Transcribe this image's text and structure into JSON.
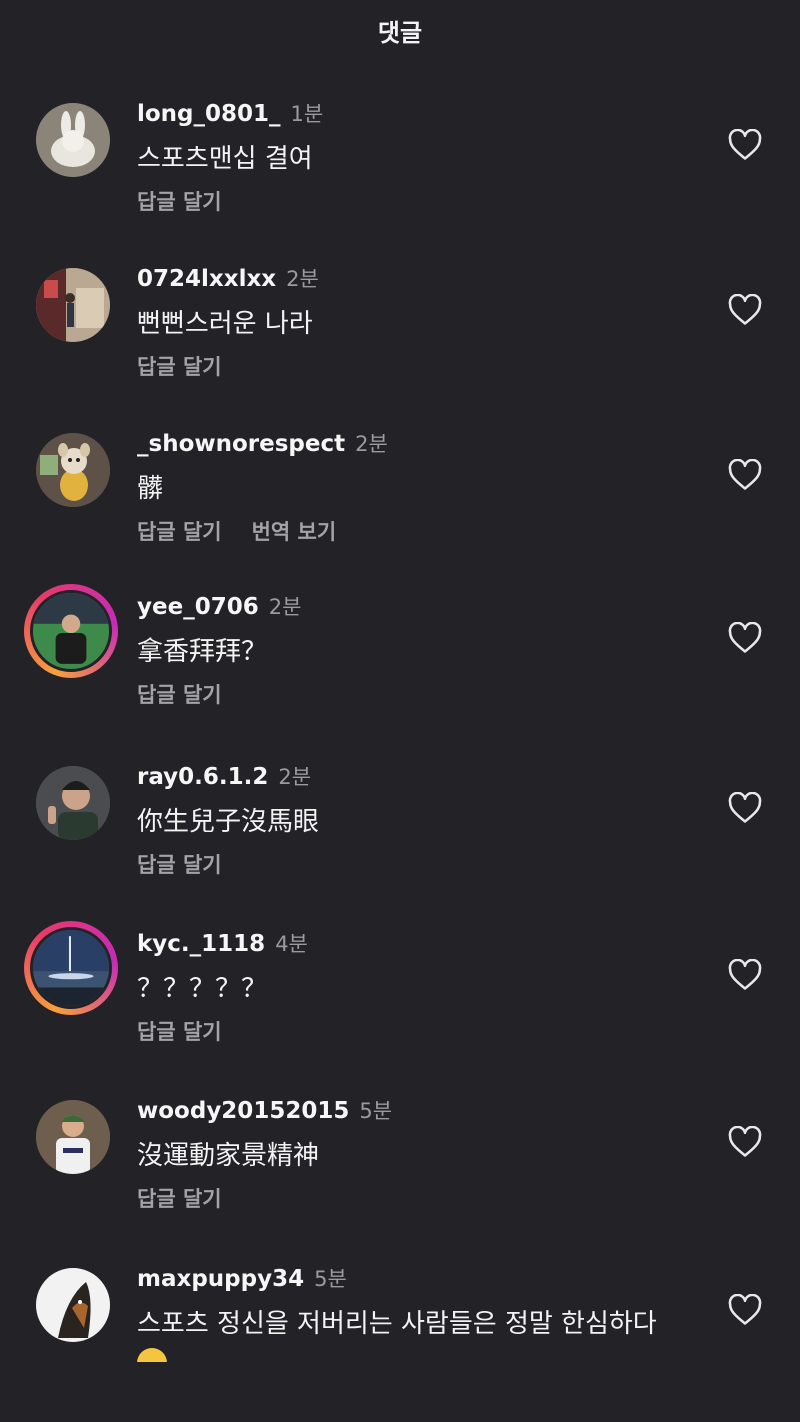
{
  "header": {
    "title": "댓글"
  },
  "comments": [
    {
      "username": "long_0801_",
      "time": "1분",
      "text": "스포츠맨십 결여",
      "reply": "답글 달기",
      "translate": "",
      "avatar": "rabbit-avatar",
      "ring": false
    },
    {
      "username": "0724lxxlxx",
      "time": "2분",
      "text": "뻔뻔스러운 나라",
      "reply": "답글 달기",
      "translate": "",
      "avatar": "room-photo-avatar",
      "ring": false
    },
    {
      "username": "_shownorespect",
      "time": "2분",
      "text": "髒",
      "reply": "답글 달기",
      "translate": "번역 보기",
      "avatar": "plush-dog-avatar",
      "ring": false
    },
    {
      "username": "yee_0706",
      "time": "2분",
      "text": "拿香拜拜？",
      "reply": "답글 달기",
      "translate": "",
      "avatar": "stadium-person-avatar",
      "ring": true
    },
    {
      "username": "ray0.6.1.2",
      "time": "2분",
      "text": "你生兒子沒馬眼",
      "reply": "답글 달기",
      "translate": "",
      "avatar": "person-gesture-avatar",
      "ring": false
    },
    {
      "username": "kyc._1118",
      "time": "4분",
      "text": "？？？？？",
      "reply": "답글 달기",
      "translate": "",
      "avatar": "night-sea-avatar",
      "ring": true
    },
    {
      "username": "woody20152015",
      "time": "5분",
      "text": "沒運動家景精神",
      "reply": "답글 달기",
      "translate": "",
      "avatar": "baseball-kid-avatar",
      "ring": false
    },
    {
      "username": "maxpuppy34",
      "time": "5분",
      "text": "스포츠 정신을 저버리는 사람들은 정말 한심하다",
      "reply": "",
      "translate": "",
      "avatar": "dog-avatar",
      "ring": false
    }
  ],
  "icons": {
    "like": "heart-outline-icon"
  },
  "colors": {
    "background": "#222227",
    "secondary_text": "#9b9b9f",
    "story_ring": "#e83a6c"
  }
}
